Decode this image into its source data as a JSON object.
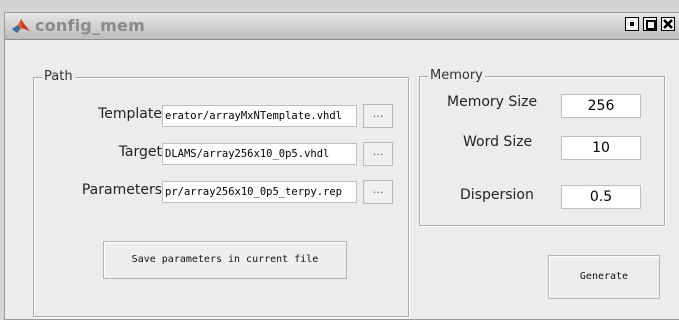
{
  "window": {
    "title": "config_mem"
  },
  "path": {
    "group_title": "Path",
    "template": {
      "label": "Template",
      "value": "erator/arrayMxNTemplate.vhdl",
      "browse": "..."
    },
    "target": {
      "label": "Target",
      "value": "DLAMS/array256x10_0p5.vhdl",
      "browse": "..."
    },
    "parameters": {
      "label": "Parameters",
      "value": "pr/array256x10_0p5_terpy.rep",
      "browse": "..."
    },
    "save_button": "Save parameters in current file"
  },
  "memory": {
    "group_title": "Memory",
    "size": {
      "label": "Memory Size",
      "value": "256"
    },
    "word": {
      "label": "Word Size",
      "value": "10"
    },
    "dispersion": {
      "label": "Dispersion",
      "value": "0.5"
    }
  },
  "generate_button": "Generate",
  "colors": {
    "title_text": "#8a8a8a",
    "background": "#ececec"
  },
  "icons": [
    "matlab-icon",
    "minimize-icon",
    "maximize-icon",
    "close-icon"
  ]
}
